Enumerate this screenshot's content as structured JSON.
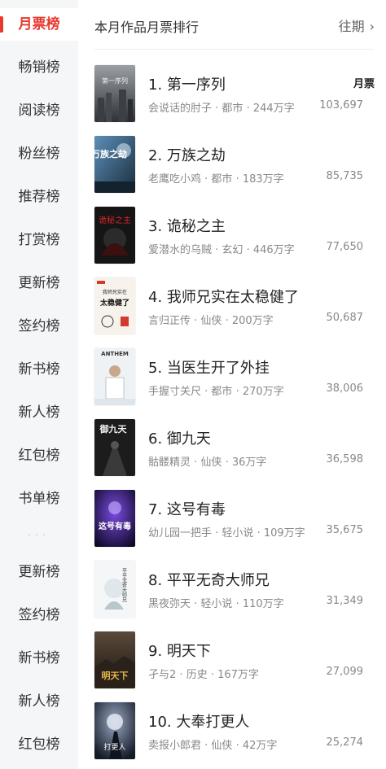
{
  "sidebar": {
    "items": [
      {
        "label": "月票榜",
        "active": true
      },
      {
        "label": "畅销榜"
      },
      {
        "label": "阅读榜"
      },
      {
        "label": "粉丝榜"
      },
      {
        "label": "推荐榜"
      },
      {
        "label": "打赏榜"
      },
      {
        "label": "更新榜"
      },
      {
        "label": "签约榜"
      },
      {
        "label": "新书榜"
      },
      {
        "label": "新人榜"
      },
      {
        "label": "红包榜"
      },
      {
        "label": "书单榜"
      },
      {
        "label": "更新榜"
      },
      {
        "label": "签约榜"
      },
      {
        "label": "新书榜"
      },
      {
        "label": "新人榜"
      },
      {
        "label": "红包榜"
      }
    ],
    "active_color": "#e8392f"
  },
  "header": {
    "title": "本月作品月票排行",
    "past_label": "往期",
    "column_label": "月票"
  },
  "books": [
    {
      "title": "1. 第一序列",
      "author": "会说话的肘子",
      "genre": "都市",
      "words": "244万字",
      "votes": "103,697",
      "cover_text": "第一序列"
    },
    {
      "title": "2. 万族之劫",
      "author": "老鹰吃小鸡",
      "genre": "都市",
      "words": "183万字",
      "votes": "85,735",
      "cover_text": "万族之劫"
    },
    {
      "title": "3. 诡秘之主",
      "author": "爱潜水的乌贼",
      "genre": "玄幻",
      "words": "446万字",
      "votes": "77,650",
      "cover_text": "诡秘之主"
    },
    {
      "title": "4. 我师兄实在太稳健了",
      "author": "言归正传",
      "genre": "仙侠",
      "words": "200万字",
      "votes": "50,687",
      "cover_text": "我师兄实在太稳健了"
    },
    {
      "title": "5. 当医生开了外挂",
      "author": "手握寸关尺",
      "genre": "都市",
      "words": "270万字",
      "votes": "38,006",
      "cover_text": "ANTHEM"
    },
    {
      "title": "6. 御九天",
      "author": "骷髅精灵",
      "genre": "仙侠",
      "words": "36万字",
      "votes": "36,598",
      "cover_text": "御九天"
    },
    {
      "title": "7. 这号有毒",
      "author": "幼儿园一把手",
      "genre": "轻小说",
      "words": "109万字",
      "votes": "35,675",
      "cover_text": "这号有毒"
    },
    {
      "title": "8. 平平无奇大师兄",
      "author": "黑夜弥天",
      "genre": "轻小说",
      "words": "110万字",
      "votes": "31,349",
      "cover_text": "平平无奇大师兄"
    },
    {
      "title": "9. 明天下",
      "author": "孑与2",
      "genre": "历史",
      "words": "167万字",
      "votes": "27,099",
      "cover_text": "明天下"
    },
    {
      "title": "10. 大奉打更人",
      "author": "卖报小郎君",
      "genre": "仙侠",
      "words": "42万字",
      "votes": "25,274",
      "cover_text": "打更人"
    }
  ]
}
